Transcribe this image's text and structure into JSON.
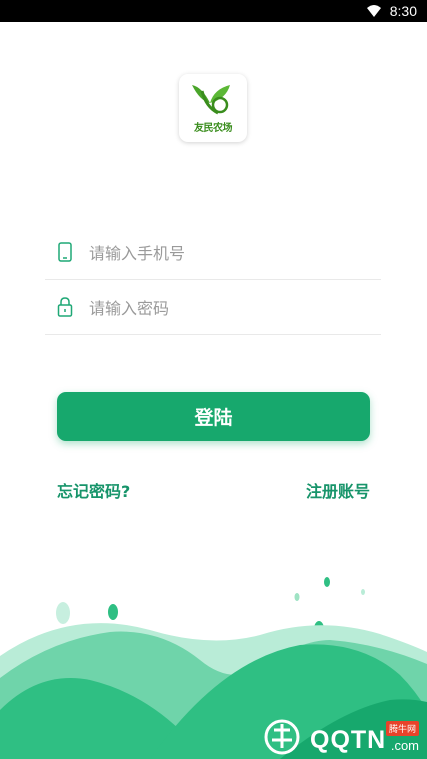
{
  "status_bar": {
    "time": "8:30"
  },
  "logo": {
    "text": "友民农场"
  },
  "phone_field": {
    "placeholder": "请输入手机号"
  },
  "password_field": {
    "placeholder": "请输入密码"
  },
  "login_button": {
    "label": "登陆"
  },
  "forgot_password": {
    "label": "忘记密码?"
  },
  "register": {
    "label": "注册账号"
  },
  "watermark": {
    "main": "QQTN",
    "sub": "腾牛网",
    "suffix": ".com"
  },
  "colors": {
    "accent": "#17a86d",
    "link": "#17946a",
    "hill_light": "#b9ecd7",
    "hill_mid": "#6fd4aa",
    "hill_dark": "#2fbf83"
  }
}
